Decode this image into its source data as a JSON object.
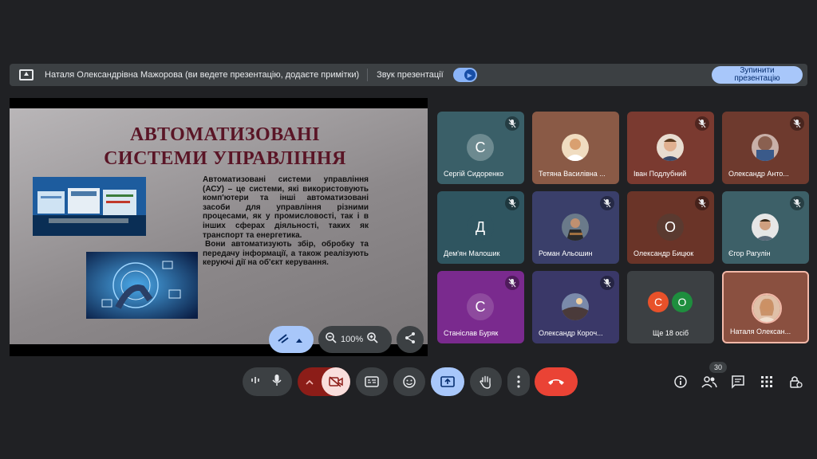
{
  "presenting_bar": {
    "message": "Наталя Олександрівна Мажорова (ви ведете презентацію, додаєте примітки)",
    "sound_label": "Звук презентації",
    "stop_button": "Зупинити презентацію"
  },
  "slide": {
    "title_line1": "АВТОМАТИЗОВАНІ",
    "title_line2": "СИСТЕМИ УПРАВЛІННЯ",
    "paragraph1": "Автоматизовані системи управління (АСУ) – це системи, які використовують комп'ютери та інші автоматизовані засоби для управління різними процесами, як у промисловості, так і в інших сферах діяльності, таких як транспорт та енергетика.",
    "paragraph2": "Вони автоматизують збір, обробку та передачу інформації, а також реалізують керуючі дії на об'єкт керування.",
    "zoom_level": "100%"
  },
  "participants": [
    {
      "name": "Сергій Сидоренко",
      "letter": "С",
      "bg": "#3a5f68",
      "avatar_bg": "#6d8a90"
    },
    {
      "name": "Тетяна Василівна ...",
      "letter": "",
      "bg": "#8a5a46",
      "avatar_bg": "#e2c9a0"
    },
    {
      "name": "Іван Подлубний",
      "letter": "",
      "bg": "#7a3a30",
      "avatar_bg": "#c4a08a"
    },
    {
      "name": "Олександр Анто...",
      "letter": "",
      "bg": "#6e3a2e",
      "avatar_bg": "#8a6a6a"
    },
    {
      "name": "Дем'ян Малошик",
      "letter": "Д",
      "bg": "#2f5560",
      "avatar_bg": "#2f5560"
    },
    {
      "name": "Роман Альошин",
      "letter": "",
      "bg": "#3a3f6a",
      "avatar_bg": "#5a4a3a"
    },
    {
      "name": "Олександр Бицюк",
      "letter": "О",
      "bg": "#6a3428",
      "avatar_bg": "#5a3a30"
    },
    {
      "name": "Єгор Рагулін",
      "letter": "",
      "bg": "#3d6068",
      "avatar_bg": "#d6d6d6"
    },
    {
      "name": "Станіслав Буряк",
      "letter": "С",
      "bg": "#7a2a8e",
      "avatar_bg": "#8e4a9e"
    },
    {
      "name": "Олександр Короч...",
      "letter": "",
      "bg": "#3a3868",
      "avatar_bg": "#6a7a9a"
    },
    {
      "name": "Ще 18 осіб",
      "letter": "",
      "bg": "#3c4043",
      "avatar_bg": "#3c4043"
    },
    {
      "name": "Наталя Олексан...",
      "letter": "",
      "bg": "#8a5040",
      "avatar_bg": "#d8a890"
    }
  ],
  "more_people": {
    "letter1": "С",
    "letter2": "О",
    "color1": "#e8512a",
    "color2": "#1e8e3e"
  },
  "people_count": "30",
  "colors": {
    "end_call": "#ea4335",
    "present_active": "#a8c7fa",
    "cam_off": "#f9dedc",
    "cam_off_wrap": "#8c1d18"
  }
}
